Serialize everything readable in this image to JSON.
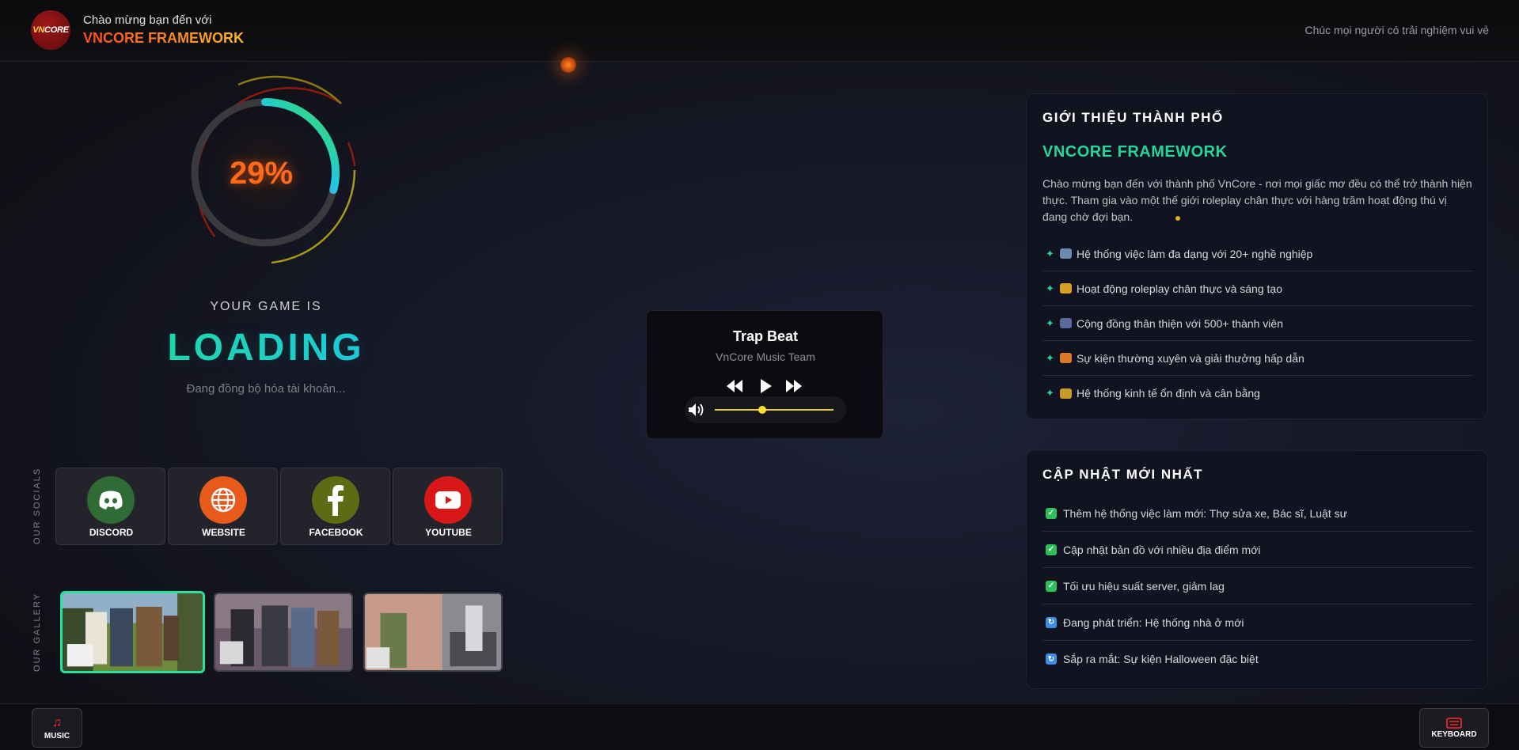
{
  "header": {
    "logo_text_a": "VN",
    "logo_text_b": "CORE",
    "welcome": "Chào mừng bạn đến với",
    "brand": "VNCORE FRAMEWORK",
    "tagline": "Chúc mọi người có trải nghiệm vui vẻ"
  },
  "loader": {
    "progress_percent": 29,
    "percent_label": "29%",
    "game_is": "YOUR GAME IS",
    "loading": "LOADING",
    "status": "Đang đồng bộ hóa tài khoản..."
  },
  "socials": {
    "section_label": "OUR SOCIALS",
    "items": [
      {
        "label": "DISCORD",
        "icon": "discord-icon",
        "color": "#2f6b34"
      },
      {
        "label": "WEBSITE",
        "icon": "globe-icon",
        "color": "#e85a1a"
      },
      {
        "label": "FACEBOOK",
        "icon": "facebook-icon",
        "color": "#5e6b14"
      },
      {
        "label": "YOUTUBE",
        "icon": "youtube-icon",
        "color": "#d81818"
      }
    ]
  },
  "gallery": {
    "section_label": "OUR GALLERY",
    "active_index": 0
  },
  "player": {
    "track": "Trap Beat",
    "artist": "VnCore Music Team",
    "volume": 0.4
  },
  "intro": {
    "title": "GIỚI THIỆU THÀNH PHỐ",
    "brand": "VNCORE FRAMEWORK",
    "description": "Chào mừng bạn đến với thành phố VnCore - nơi mọi giấc mơ đều có thể trở thành hiện thực. Tham gia vào một thế giới roleplay chân thực với hàng trăm hoạt động thú vị đang chờ đợi bạn.",
    "features": [
      {
        "text": "Hệ thống việc làm đa dạng với 20+ nghề nghiệp",
        "icon": "office-icon"
      },
      {
        "text": "Hoạt động roleplay chân thực và sáng tạo",
        "icon": "masks-icon"
      },
      {
        "text": "Cộng đồng thân thiện với 500+ thành viên",
        "icon": "people-icon"
      },
      {
        "text": "Sự kiện thường xuyên và giải thưởng hấp dẫn",
        "icon": "party-icon"
      },
      {
        "text": "Hệ thống kinh tế ổn định và cân bằng",
        "icon": "money-bag-icon"
      }
    ]
  },
  "updates": {
    "title": "CẬP NHẬT MỚI NHẤT",
    "items": [
      {
        "text": "Thêm hệ thống việc làm mới: Thợ sửa xe, Bác sĩ, Luật sư",
        "status": "done"
      },
      {
        "text": "Cập nhật bản đồ với nhiều địa điểm mới",
        "status": "done"
      },
      {
        "text": "Tối ưu hiệu suất server, giảm lag",
        "status": "done"
      },
      {
        "text": "Đang phát triển: Hệ thống nhà ở mới",
        "status": "in-progress"
      },
      {
        "text": "Sắp ra mắt: Sự kiện Halloween đặc biệt",
        "status": "in-progress"
      }
    ]
  },
  "footer": {
    "music_label": "MUSIC",
    "keyboard_label": "KEYBOARD"
  },
  "colors": {
    "accent_green": "#23d59a",
    "accent_orange": "#ff6a1a",
    "done": "#2fbf5a",
    "in_progress": "#3a8ee6"
  }
}
